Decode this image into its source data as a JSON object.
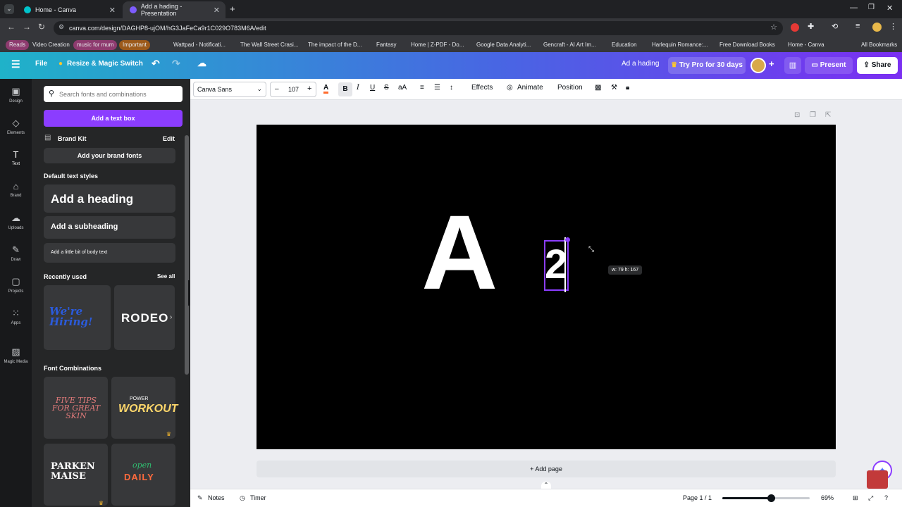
{
  "browser": {
    "tabs": [
      {
        "title": "Home - Canva",
        "active": false
      },
      {
        "title": "Add a hading - Presentation",
        "active": true
      }
    ],
    "url": "canva.com/design/DAGHP8-ujOM/hG3JaFeCa9r1C029O783M6A/edit",
    "bookmarks": [
      "Reads",
      "Video Creation",
      "music for mum",
      "Important",
      "Wattpad - Notificati...",
      "The Wall Street Crasi...",
      "The impact of the D...",
      "Fantasy",
      "Home | Z-PDF - Do...",
      "Google Data Analyti...",
      "Gencraft - AI Art Im...",
      "Education",
      "Harlequin Romance:...",
      "Free Download Books",
      "Home - Canva"
    ],
    "all_bookmarks": "All Bookmarks"
  },
  "canva_bar": {
    "file": "File",
    "resize": "Resize & Magic Switch",
    "doc_title": "Ad a hading",
    "try_pro": "Try Pro for 30 days",
    "present": "Present",
    "share": "Share"
  },
  "rail": [
    {
      "label": "Design",
      "icon": "design-icon"
    },
    {
      "label": "Elements",
      "icon": "elements-icon"
    },
    {
      "label": "Text",
      "icon": "text-icon"
    },
    {
      "label": "Brand",
      "icon": "brand-icon"
    },
    {
      "label": "Uploads",
      "icon": "uploads-icon"
    },
    {
      "label": "Draw",
      "icon": "draw-icon"
    },
    {
      "label": "Projects",
      "icon": "projects-icon"
    },
    {
      "label": "Apps",
      "icon": "apps-icon"
    },
    {
      "label": "Magic Media",
      "icon": "magic-media-icon"
    }
  ],
  "panel": {
    "search_placeholder": "Search fonts and combinations",
    "add_text_box": "Add a text box",
    "brand_kit": "Brand Kit",
    "edit": "Edit",
    "add_brand_fonts": "Add your brand fonts",
    "default_styles": "Default text styles",
    "heading": "Add a heading",
    "subheading": "Add a subheading",
    "body": "Add a little bit of body text",
    "recently_used": "Recently used",
    "see_all": "See all",
    "recent": [
      "We're Hiring!",
      "RODEO"
    ],
    "font_combinations": "Font Combinations",
    "combos": [
      "FIVE TIPS FOR GREAT SKIN",
      "WORKOUT",
      "PARKEN MAISE",
      "DAILY"
    ],
    "combo_small": [
      "POWER",
      "open"
    ]
  },
  "toolbar": {
    "font": "Canva Sans",
    "font_size": "107",
    "effects": "Effects",
    "animate": "Animate",
    "position": "Position"
  },
  "canvas": {
    "letter": "A",
    "digit": "2",
    "size_tooltip": "w: 79 h: 167"
  },
  "add_page": "+ Add page",
  "footer": {
    "notes": "Notes",
    "timer": "Timer",
    "page": "Page 1 / 1",
    "zoom": "69%",
    "zoom_fraction": 0.56
  },
  "colors": {
    "accent": "#8b3dff",
    "canvas_bg": "#000000"
  }
}
